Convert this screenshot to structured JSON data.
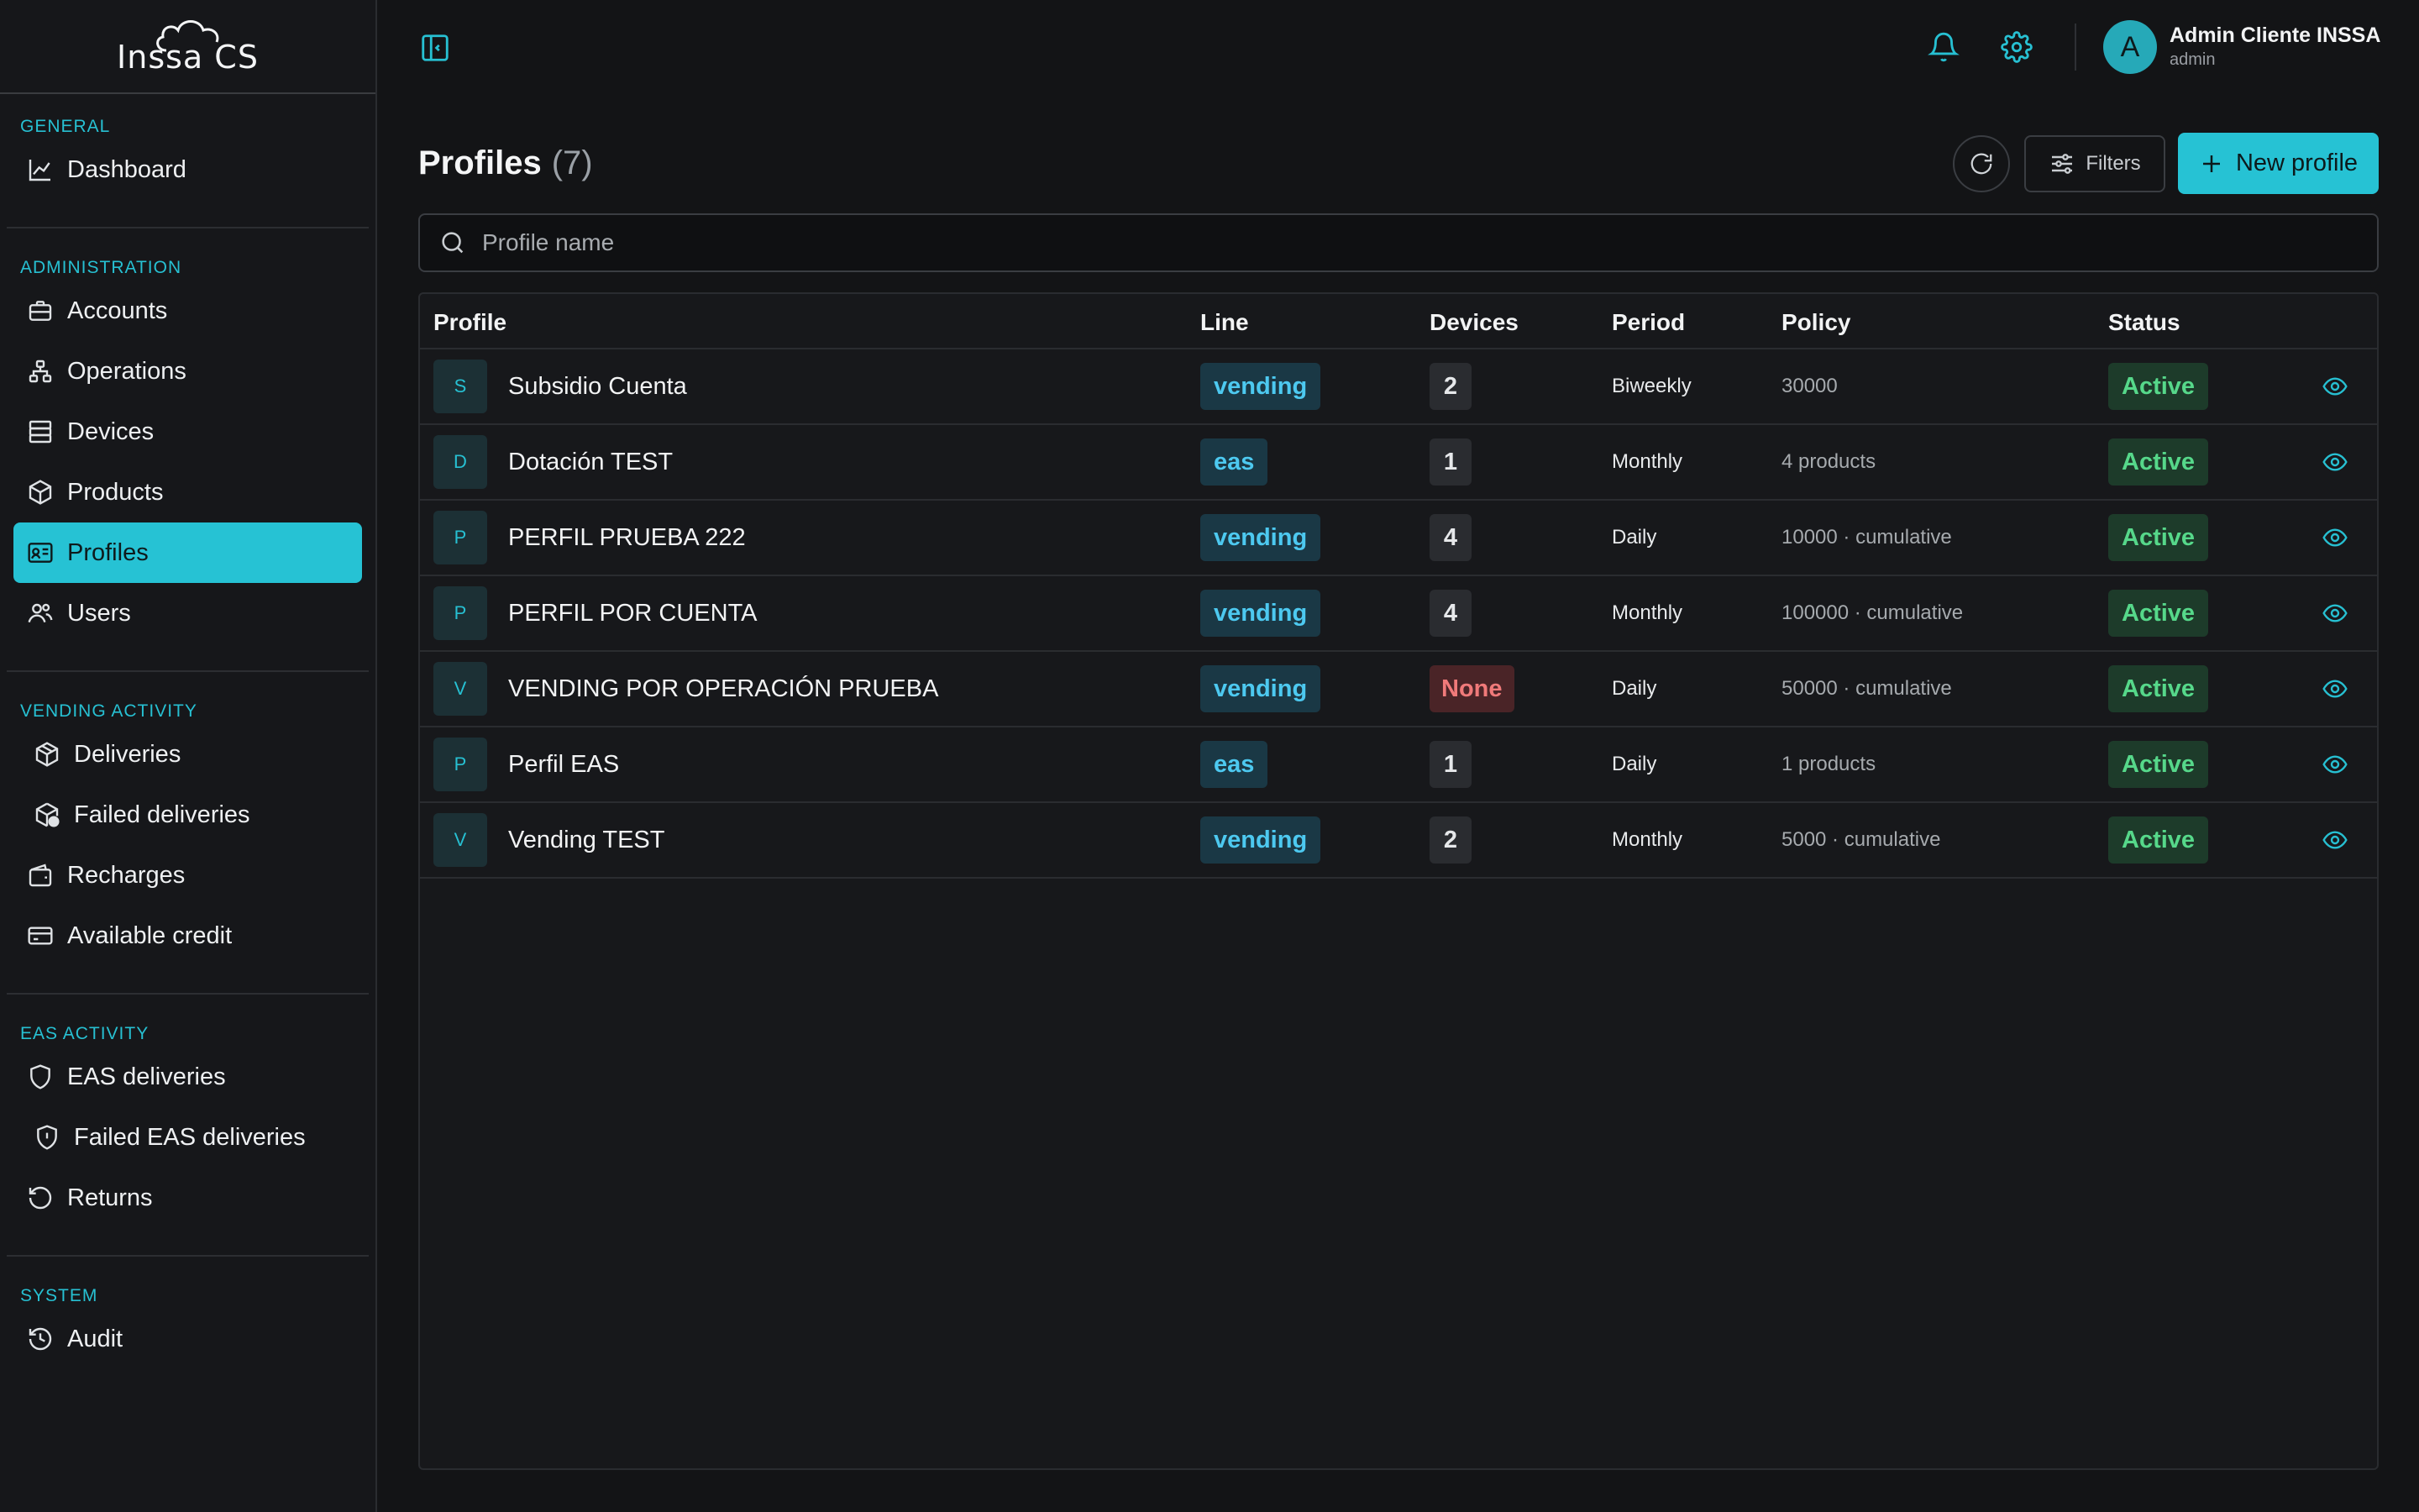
{
  "app": {
    "logo_text": "Inssa CS"
  },
  "sidebar": {
    "sections": [
      {
        "heading": "GENERAL",
        "items": [
          {
            "label": "Dashboard",
            "icon": "chart-line-icon"
          }
        ]
      },
      {
        "heading": "ADMINISTRATION",
        "items": [
          {
            "label": "Accounts",
            "icon": "briefcase-icon"
          },
          {
            "label": "Operations",
            "icon": "hierarchy-icon"
          },
          {
            "label": "Devices",
            "icon": "server-icon"
          },
          {
            "label": "Products",
            "icon": "box-icon"
          },
          {
            "label": "Profiles",
            "icon": "id-card-icon",
            "active": true
          },
          {
            "label": "Users",
            "icon": "users-icon"
          }
        ]
      },
      {
        "heading": "VENDING ACTIVITY",
        "items": [
          {
            "label": "Deliveries",
            "icon": "package-icon"
          },
          {
            "label": "Failed deliveries",
            "icon": "package-alert-icon"
          },
          {
            "label": "Recharges",
            "icon": "wallet-icon"
          },
          {
            "label": "Available credit",
            "icon": "credit-card-icon"
          }
        ]
      },
      {
        "heading": "EAS ACTIVITY",
        "items": [
          {
            "label": "EAS deliveries",
            "icon": "shield-icon"
          },
          {
            "label": "Failed EAS deliveries",
            "icon": "shield-alert-icon"
          },
          {
            "label": "Returns",
            "icon": "rotate-ccw-icon"
          }
        ]
      },
      {
        "heading": "SYSTEM",
        "items": [
          {
            "label": "Audit",
            "icon": "history-icon"
          }
        ]
      }
    ]
  },
  "topbar": {
    "user_initial": "A",
    "user_name": "Admin Cliente INSSA",
    "user_role": "admin"
  },
  "page": {
    "title": "Profiles",
    "count": "(7)",
    "filters_label": "Filters",
    "new_label": "New profile",
    "search_placeholder": "Profile name"
  },
  "table": {
    "columns": [
      "Profile",
      "Line",
      "Devices",
      "Period",
      "Policy",
      "Status"
    ],
    "rows": [
      {
        "initial": "S",
        "name": "Subsidio Cuenta",
        "line": "vending",
        "devices": "2",
        "period": "Biweekly",
        "policy": "30000",
        "status": "Active"
      },
      {
        "initial": "D",
        "name": "Dotación TEST",
        "line": "eas",
        "devices": "1",
        "period": "Monthly",
        "policy": "4 products",
        "status": "Active"
      },
      {
        "initial": "P",
        "name": "PERFIL PRUEBA 222",
        "line": "vending",
        "devices": "4",
        "period": "Daily",
        "policy": "10000 · cumulative",
        "status": "Active"
      },
      {
        "initial": "P",
        "name": "PERFIL POR CUENTA",
        "line": "vending",
        "devices": "4",
        "period": "Monthly",
        "policy": "100000 · cumulative",
        "status": "Active"
      },
      {
        "initial": "V",
        "name": "VENDING POR OPERACIÓN PRUEBA",
        "line": "vending",
        "devices": "None",
        "period": "Daily",
        "policy": "50000 · cumulative",
        "status": "Active"
      },
      {
        "initial": "P",
        "name": "Perfil EAS",
        "line": "eas",
        "devices": "1",
        "period": "Daily",
        "policy": "1 products",
        "status": "Active"
      },
      {
        "initial": "V",
        "name": "Vending TEST",
        "line": "vending",
        "devices": "2",
        "period": "Monthly",
        "policy": "5000 · cumulative",
        "status": "Active"
      }
    ]
  },
  "colors": {
    "accent": "#26c2d4",
    "active_green": "#56d88a",
    "none_red": "#f07a7a",
    "line_blue": "#4dc9f0"
  }
}
